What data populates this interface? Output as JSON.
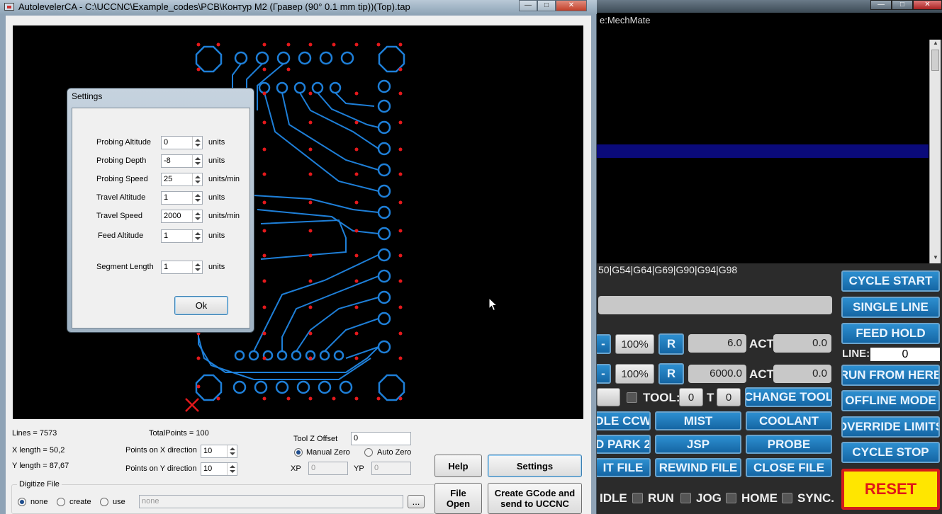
{
  "autoleveler": {
    "title": "AutolevelerCA - C:\\UCCNC\\Example_codes\\PCB\\Контур М2 (Гравер (90° 0.1 mm tip))(Top).tap",
    "window_buttons": {
      "minimize": "—",
      "maximize": "□",
      "close": "✕"
    },
    "info": {
      "lines": "Lines =  7573",
      "total_points": "TotalPoints = 100",
      "x_length": "X length = 50,2",
      "y_length": "Y length = 87,67"
    },
    "points_x": {
      "label": "Points on X direction",
      "value": "10"
    },
    "points_y": {
      "label": "Points on Y direction",
      "value": "10"
    },
    "tool_z_offset": {
      "label": "Tool Z Offset",
      "value": "0"
    },
    "zero_mode": {
      "manual": "Manual Zero",
      "auto": "Auto Zero",
      "selected": "manual"
    },
    "xp": {
      "label": "XP",
      "value": "0"
    },
    "yp": {
      "label": "YP",
      "value": "0"
    },
    "digitize": {
      "legend": "Digitize File",
      "none": "none",
      "create": "create",
      "use": "use",
      "selected": "none",
      "file_value": "none",
      "browse": "..."
    },
    "buttons": {
      "help": "Help",
      "settings": "Settings",
      "file_open": "File Open",
      "create_gcode": "Create GCode and send to UCCNC"
    }
  },
  "settings_dialog": {
    "title": "Settings",
    "rows": [
      {
        "label": "Probing Altitude",
        "value": "0",
        "unit": "units"
      },
      {
        "label": "Probing Depth",
        "value": "-8",
        "unit": "units"
      },
      {
        "label": "Probing Speed",
        "value": "25",
        "unit": "units/min"
      },
      {
        "label": "Travel Altitude",
        "value": "1",
        "unit": "units"
      },
      {
        "label": "Travel Speed",
        "value": "2000",
        "unit": "units/min"
      },
      {
        "label": "Feed Altitude",
        "value": "1",
        "unit": "units"
      },
      {
        "label": "Segment Length",
        "value": "1",
        "unit": "units"
      }
    ],
    "ok": "Ok"
  },
  "uccnc": {
    "machine_text": "e:MechMate",
    "gcode_modes": "50|G54|G64|G69|G90|G94|G98",
    "feed": {
      "override": "100%",
      "reset": "R",
      "set": "6.0",
      "act_label": "ACT:",
      "act": "0.0"
    },
    "spindle": {
      "override": "100%",
      "reset": "R",
      "set": "6000.0",
      "act_label": "ACT:",
      "act": "0.0"
    },
    "tool": {
      "label": "TOOL:",
      "value": "0",
      "t_label": "T",
      "t_value": "0",
      "change": "CHANGE TOOL"
    },
    "line": {
      "label": "LINE:",
      "value": "0"
    },
    "right_buttons": [
      "CYCLE START",
      "SINGLE LINE",
      "FEED HOLD",
      "RUN FROM HERE",
      "OFFLINE MODE",
      "OVERRIDE LIMITS",
      "CYCLE STOP"
    ],
    "reset": "RESET",
    "row1": [
      "DLE CCW",
      "MIST",
      "COOLANT"
    ],
    "row2": [
      "D PARK 2",
      "JSP",
      "PROBE"
    ],
    "row3": [
      "IT FILE",
      "REWIND FILE",
      "CLOSE FILE"
    ],
    "status": [
      "IDLE",
      "RUN",
      "JOG",
      "HOME",
      "SYNC."
    ],
    "minus": "-"
  }
}
